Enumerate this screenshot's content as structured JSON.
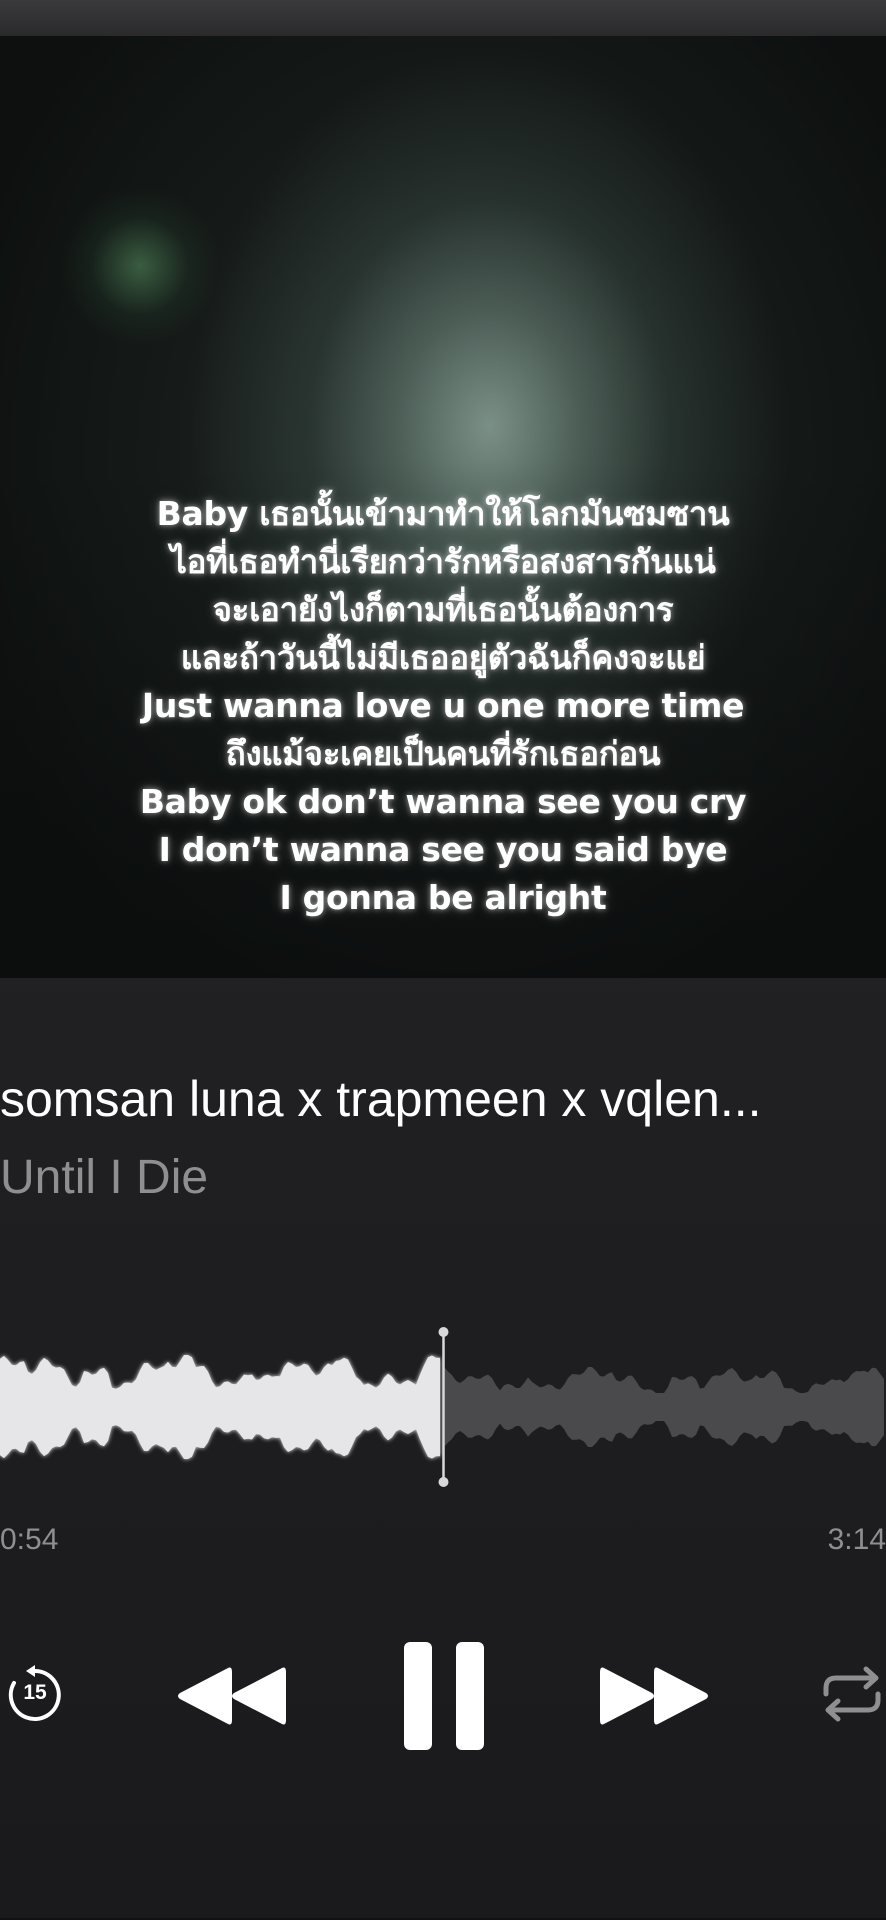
{
  "now_playing": {
    "lyrics": [
      "Baby เธอนั้นเข้ามาทำให้โลกมันซมซาน",
      "ไอที่เธอทำนี่เรียกว่ารักหรือสงสารกันแน่",
      "จะเอายังไงก็ตามที่เธอนั้นต้องการ",
      "และถ้าวันนี้ไม่มีเธออยู่ตัวฉันก็คงจะแย่",
      "Just wanna love u one more time",
      "ถึงแม้จะเคยเป็นคนที่รักเธอก่อน",
      "Baby ok don’t wanna see you cry",
      "I don’t wanna see you said bye",
      "I gonna be alright"
    ],
    "artist": "somsan luna x trapmeen x vqlen...",
    "song_title": "Until I Die"
  },
  "playback": {
    "elapsed": "0:54",
    "total": "3:14",
    "progress_fraction": 0.5
  },
  "controls": {
    "skip_back_seconds": "15",
    "skip_back_icon": "skip-back-15-icon",
    "rewind_icon": "rewind-icon",
    "pause_icon": "pause-icon",
    "forward_icon": "fast-forward-icon",
    "repeat_icon": "repeat-icon"
  },
  "colors": {
    "background": "#1c1c1e",
    "played_wave": "#e6e6e8",
    "unplayed_wave": "#4a4a4c",
    "secondary_text": "#8e8e93"
  }
}
